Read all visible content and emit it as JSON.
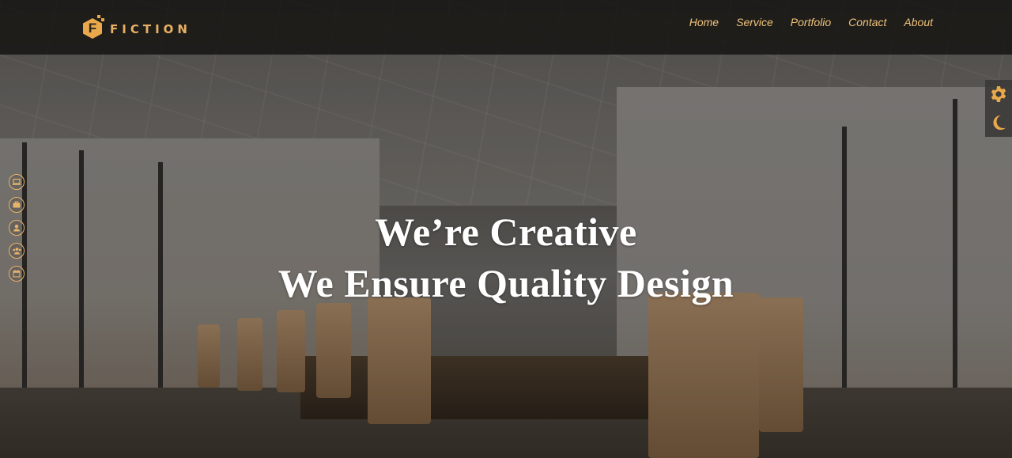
{
  "brand": {
    "logo_letter": "F",
    "name": "FICTION"
  },
  "nav": {
    "items": [
      "Home",
      "Service",
      "Portfolio",
      "Contact",
      "About"
    ]
  },
  "hero": {
    "line1": "We’re Creative",
    "line2": "We Ensure Quality Design"
  },
  "tools": {
    "settings_icon": "gear-icon",
    "theme_icon": "moon-icon"
  },
  "left_icons": [
    "laptop-icon",
    "briefcase-icon",
    "user-icon",
    "team-icon",
    "calendar-icon"
  ],
  "colors": {
    "accent": "#e9a94a",
    "nav_text": "#f0c27a",
    "header_bg": "#141210",
    "hero_text": "#ffffff"
  }
}
